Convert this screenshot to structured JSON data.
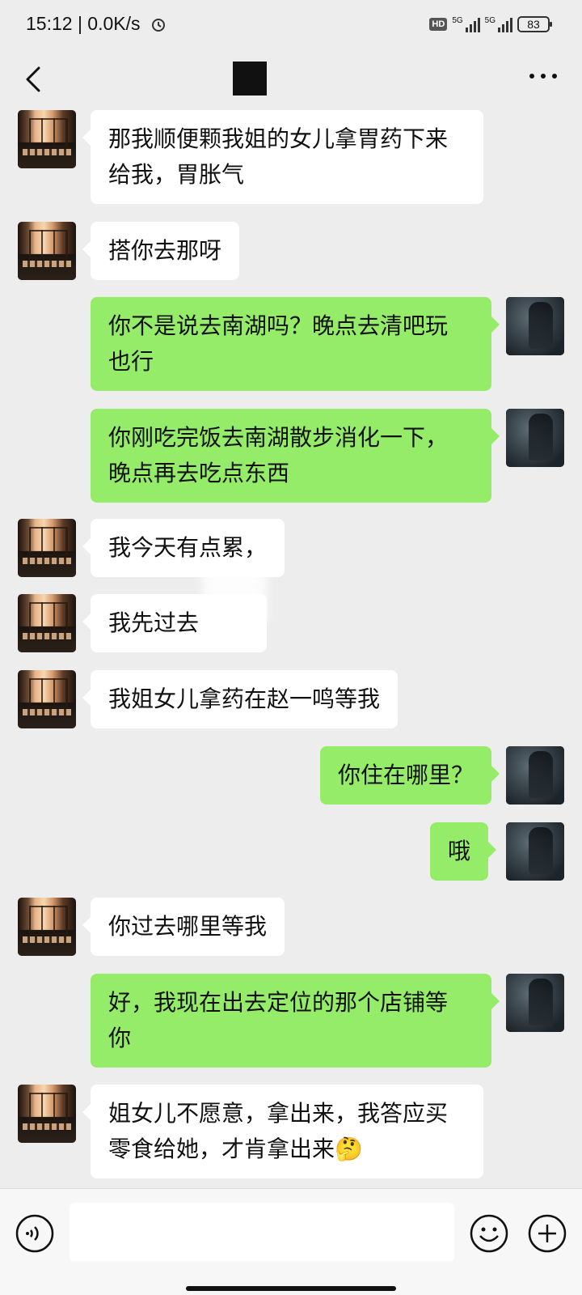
{
  "status_bar": {
    "time": "15:12 | 0.0K/s",
    "hd_label": "HD",
    "signal1_label": "5G",
    "signal2_label": "5G",
    "battery": "83"
  },
  "nav": {
    "back_icon": "chevron-left-icon",
    "more_icon": "more-horizontal-icon"
  },
  "messages": [
    {
      "side": "left",
      "text": "那我顺便颗我姐的女儿拿胃药下来\n给我，胃胀气"
    },
    {
      "side": "left",
      "text": "搭你去那呀"
    },
    {
      "side": "right",
      "text": "你不是说去南湖吗？晚点去清吧玩\n也行"
    },
    {
      "side": "right",
      "text": "你刚吃完饭去南湖散步消化一下，\n晚点再去吃点东西"
    },
    {
      "side": "left",
      "text": "我今天有点累，"
    },
    {
      "side": "left",
      "text": "我先过去"
    },
    {
      "side": "left",
      "text": "我姐女儿拿药在赵一鸣等我"
    },
    {
      "side": "right",
      "text": "你住在哪里？"
    },
    {
      "side": "right",
      "text": "哦"
    },
    {
      "side": "left",
      "text": "你过去哪里等我"
    },
    {
      "side": "right",
      "text": "好，我现在出去定位的那个店铺等\n你"
    },
    {
      "side": "left",
      "text": "姐女儿不愿意，拿出来，我答应买\n零食给她，才肯拿出来🤔"
    }
  ],
  "input": {
    "voice_icon": "voice-icon",
    "placeholder": "",
    "emoji_icon": "emoji-icon",
    "plus_icon": "plus-icon"
  }
}
